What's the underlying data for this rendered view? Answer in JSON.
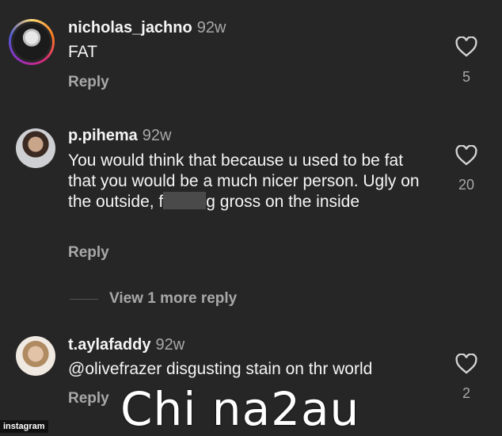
{
  "comments": [
    {
      "username": "nicholas_jachno",
      "time": "92w",
      "text": "FAT",
      "reply": "Reply",
      "likes": "5"
    },
    {
      "username": "p.pihema",
      "time": "92w",
      "text_before": "You would think that because u used to be fat that you would be a much nicer person. Ugly on the outside, f",
      "text_after": "g gross on the inside",
      "reply": "Reply",
      "likes": "20"
    },
    {
      "username": "t.aylafaddy",
      "time": "92w",
      "text": "@olivefrazer disgusting stain on thr world",
      "reply": "Reply",
      "likes": "2"
    }
  ],
  "view_more": "View 1 more reply",
  "watermark": "Chi na2au",
  "source_tag": "instagram",
  "icons": {
    "like": "heart-icon"
  },
  "colors": {
    "background": "#262626",
    "text": "#f5f5f5",
    "muted": "#a8a8a8"
  }
}
